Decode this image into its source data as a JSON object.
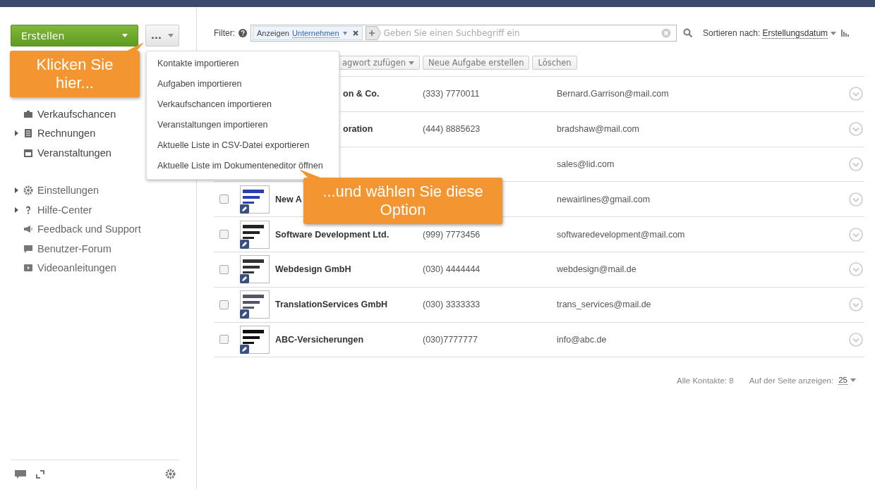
{
  "create_button": {
    "label": "Erstellen"
  },
  "more_button": {
    "label": "..."
  },
  "sidebar": {
    "groups": [
      [
        {
          "label": "Verkaufschancen",
          "expandable": false
        },
        {
          "label": "Rechnungen",
          "expandable": true
        },
        {
          "label": "Veranstaltungen",
          "expandable": false
        }
      ],
      [
        {
          "label": "Einstellungen",
          "expandable": true
        },
        {
          "label": "Hilfe-Center",
          "expandable": true
        },
        {
          "label": "Feedback und Support",
          "expandable": false
        },
        {
          "label": "Benutzer-Forum",
          "expandable": false
        },
        {
          "label": "Videoanleitungen",
          "expandable": false
        }
      ]
    ]
  },
  "filter": {
    "label": "Filter:",
    "tag": {
      "prefix": "Anzeigen",
      "value": "Unternehmen"
    },
    "placeholder": "Geben Sie einen Suchbegriff ein"
  },
  "sort": {
    "label": "Sortieren nach:",
    "value": "Erstellungsdatum"
  },
  "toolbar": [
    "agwort zufügen",
    "Neue Aufgabe erstellen",
    "Löschen"
  ],
  "rows": [
    {
      "kind": "partial",
      "name": "on & Co.",
      "phone": "(333) 7770011",
      "email": "Bernard.Garrison@mail.com"
    },
    {
      "kind": "partial",
      "name": "oration",
      "phone": "(444) 8885623",
      "email": "bradshaw@mail.com"
    },
    {
      "kind": "hidden",
      "email": "sales@lid.com"
    },
    {
      "kind": "full",
      "checked": false,
      "name": "New A",
      "email": "newairlines@gmail.com"
    },
    {
      "kind": "full",
      "checked": false,
      "name": "Software Development Ltd.",
      "phone": "(999) 7773456",
      "email": "softwaredevelopment@mail.com"
    },
    {
      "kind": "full",
      "checked": false,
      "name": "Webdesign GmbH",
      "phone": "(030) 4444444",
      "email": "webdesign@mail.de"
    },
    {
      "kind": "full",
      "checked": false,
      "name": "TranslationServices GmbH",
      "phone": "(030) 3333333",
      "email": "trans_services@mail.de"
    },
    {
      "kind": "full",
      "checked": false,
      "name": "ABC-Versicherungen",
      "phone": "(030)7777777",
      "email": "info@abc.de"
    }
  ],
  "footer": {
    "total": "Alle Kontakte: 8",
    "per_page_label": "Auf der Seite anzeigen:",
    "per_page": "25"
  },
  "menu": [
    "Kontakte importieren",
    "Aufgaben importieren",
    "Verkaufschancen importieren",
    "Veranstaltungen importieren",
    "Aktuelle Liste in CSV-Datei exportieren",
    "Aktuelle Liste im Dokumenteneditor öffnen"
  ],
  "callouts": [
    "Klicken Sie hier...",
    "...und wählen Sie diese Option"
  ]
}
